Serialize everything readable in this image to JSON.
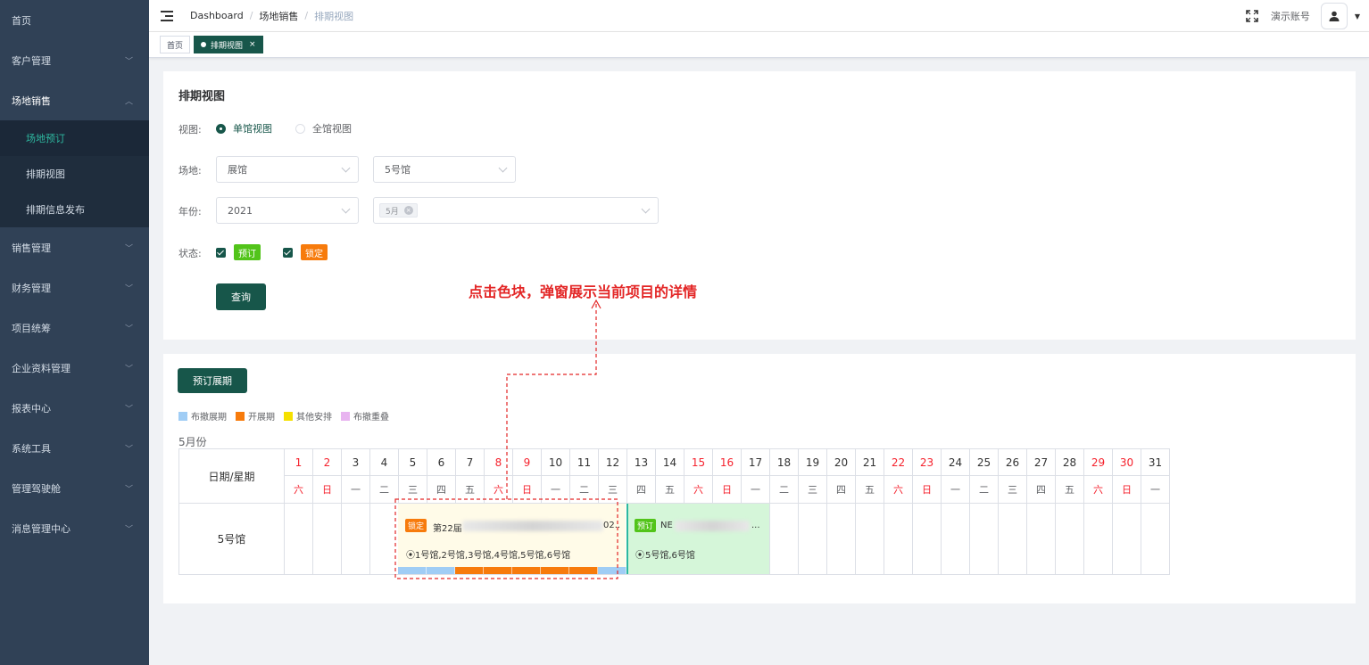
{
  "sidebar": {
    "items": [
      {
        "label": "首页"
      },
      {
        "label": "客户管理"
      },
      {
        "label": "场地销售"
      },
      {
        "label": "销售管理"
      },
      {
        "label": "财务管理"
      },
      {
        "label": "项目统筹"
      },
      {
        "label": "企业资料管理"
      },
      {
        "label": "报表中心"
      },
      {
        "label": "系统工具"
      },
      {
        "label": "管理驾驶舱"
      },
      {
        "label": "消息管理中心"
      }
    ],
    "sub_items": [
      {
        "label": "场地预订"
      },
      {
        "label": "排期视图"
      },
      {
        "label": "排期信息发布"
      }
    ]
  },
  "header": {
    "breadcrumb": [
      "Dashboard",
      "场地销售",
      "排期视图"
    ],
    "account": "演示账号"
  },
  "tags": {
    "home": "首页",
    "active": "排期视图"
  },
  "filter": {
    "title": "排期视图",
    "view_label": "视图:",
    "view_single": "单馆视图",
    "view_all": "全馆视图",
    "venue_label": "场地:",
    "venue_type": "展馆",
    "hall": "5号馆",
    "year_label": "年份:",
    "year": "2021",
    "month_chip": "5月",
    "status_label": "状态:",
    "status_reserved": "预订",
    "status_locked": "锁定",
    "query_btn": "查询"
  },
  "annotation": "点击色块，弹窗展示当前项目的详情",
  "schedule": {
    "book_btn": "预订展期",
    "legend": [
      {
        "label": "布撤展期",
        "color": "#a0cdf5"
      },
      {
        "label": "开展期",
        "color": "#f77b0c"
      },
      {
        "label": "其他安排",
        "color": "#f5e000"
      },
      {
        "label": "布撤重叠",
        "color": "#e8b4f0"
      }
    ],
    "month_label": "5月份",
    "corner": "日期/星期",
    "days": [
      {
        "d": "1",
        "w": "六",
        "red": true
      },
      {
        "d": "2",
        "w": "日",
        "red": true
      },
      {
        "d": "3",
        "w": "一",
        "red": false
      },
      {
        "d": "4",
        "w": "二",
        "red": false
      },
      {
        "d": "5",
        "w": "三",
        "red": false
      },
      {
        "d": "6",
        "w": "四",
        "red": false
      },
      {
        "d": "7",
        "w": "五",
        "red": false
      },
      {
        "d": "8",
        "w": "六",
        "red": true
      },
      {
        "d": "9",
        "w": "日",
        "red": true
      },
      {
        "d": "10",
        "w": "一",
        "red": false
      },
      {
        "d": "11",
        "w": "二",
        "red": false
      },
      {
        "d": "12",
        "w": "三",
        "red": false
      },
      {
        "d": "13",
        "w": "四",
        "red": false
      },
      {
        "d": "14",
        "w": "五",
        "red": false
      },
      {
        "d": "15",
        "w": "六",
        "red": true
      },
      {
        "d": "16",
        "w": "日",
        "red": true
      },
      {
        "d": "17",
        "w": "一",
        "red": false
      },
      {
        "d": "18",
        "w": "二",
        "red": false
      },
      {
        "d": "19",
        "w": "三",
        "red": false
      },
      {
        "d": "20",
        "w": "四",
        "red": false
      },
      {
        "d": "21",
        "w": "五",
        "red": false
      },
      {
        "d": "22",
        "w": "六",
        "red": true
      },
      {
        "d": "23",
        "w": "日",
        "red": true
      },
      {
        "d": "24",
        "w": "一",
        "red": false
      },
      {
        "d": "25",
        "w": "二",
        "red": false
      },
      {
        "d": "26",
        "w": "三",
        "red": false
      },
      {
        "d": "27",
        "w": "四",
        "red": false
      },
      {
        "d": "28",
        "w": "五",
        "red": false
      },
      {
        "d": "29",
        "w": "六",
        "red": true
      },
      {
        "d": "30",
        "w": "日",
        "red": true
      },
      {
        "d": "31",
        "w": "一",
        "red": false
      }
    ],
    "row_label": "5号馆",
    "blocks": [
      {
        "status": "锁定",
        "title_prefix": "第22届",
        "title_suffix": "02..",
        "halls": "1号馆,2号馆,3号馆,4号馆,5号馆,6号馆"
      },
      {
        "status": "预订",
        "title_prefix": "NE",
        "title_suffix": "...",
        "halls": "5号馆,6号馆"
      }
    ]
  }
}
